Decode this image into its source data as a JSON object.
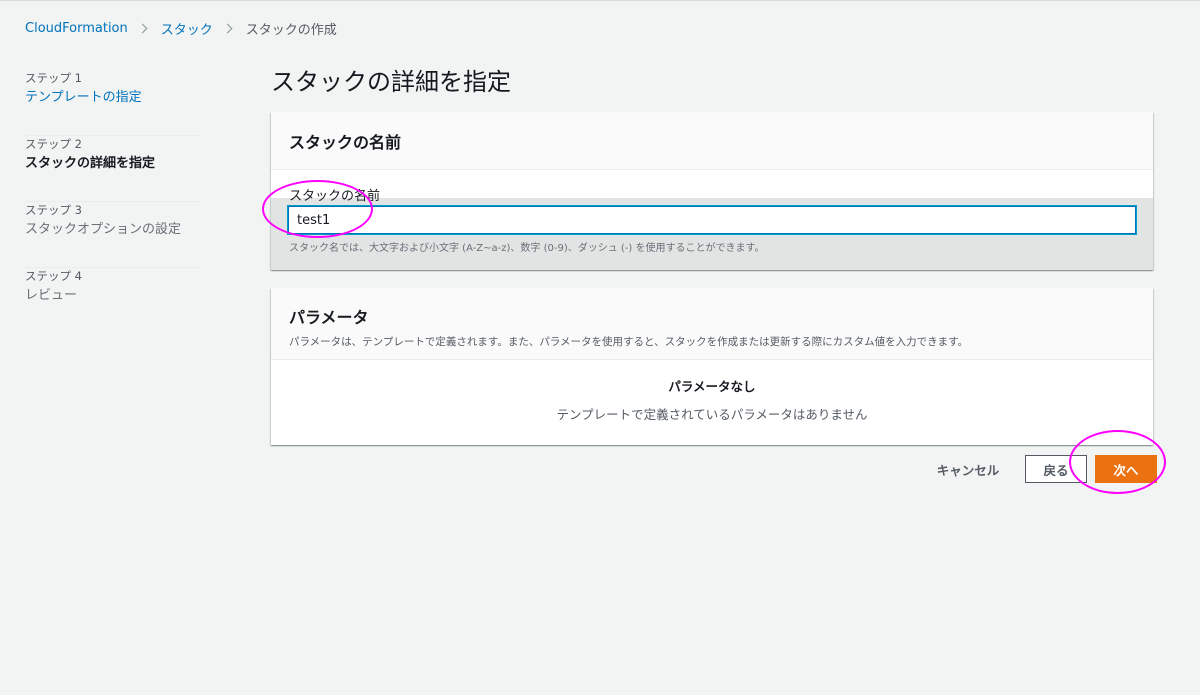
{
  "breadcrumb": {
    "items": [
      "CloudFormation",
      "スタック"
    ],
    "current": "スタックの作成"
  },
  "sidebar": {
    "steps": [
      {
        "number": "ステップ 1",
        "label": "テンプレートの指定",
        "state": "link"
      },
      {
        "number": "ステップ 2",
        "label": "スタックの詳細を指定",
        "state": "active"
      },
      {
        "number": "ステップ 3",
        "label": "スタックオプションの設定",
        "state": "disabled"
      },
      {
        "number": "ステップ 4",
        "label": "レビュー",
        "state": "disabled"
      }
    ]
  },
  "main": {
    "title": "スタックの詳細を指定",
    "stack_name_panel": {
      "title": "スタックの名前",
      "field_label": "スタックの名前",
      "value": "test1",
      "hint": "スタック名では、大文字および小文字 (A-Z~a-z)、数字 (0-9)、ダッシュ (-) を使用することができます。"
    },
    "parameters_panel": {
      "title": "パラメータ",
      "description": "パラメータは、テンプレートで定義されます。また、パラメータを使用すると、スタックを作成または更新する際にカスタム値を入力できます。",
      "empty_title": "パラメータなし",
      "empty_desc": "テンプレートで定義されているパラメータはありません"
    }
  },
  "footer": {
    "cancel_label": "キャンセル",
    "back_label": "戻る",
    "next_label": "次へ"
  },
  "colors": {
    "link": "#0073bb",
    "primary_button": "#ec7211",
    "annotation": "#ff00ff",
    "background": "#f2f3f3"
  }
}
